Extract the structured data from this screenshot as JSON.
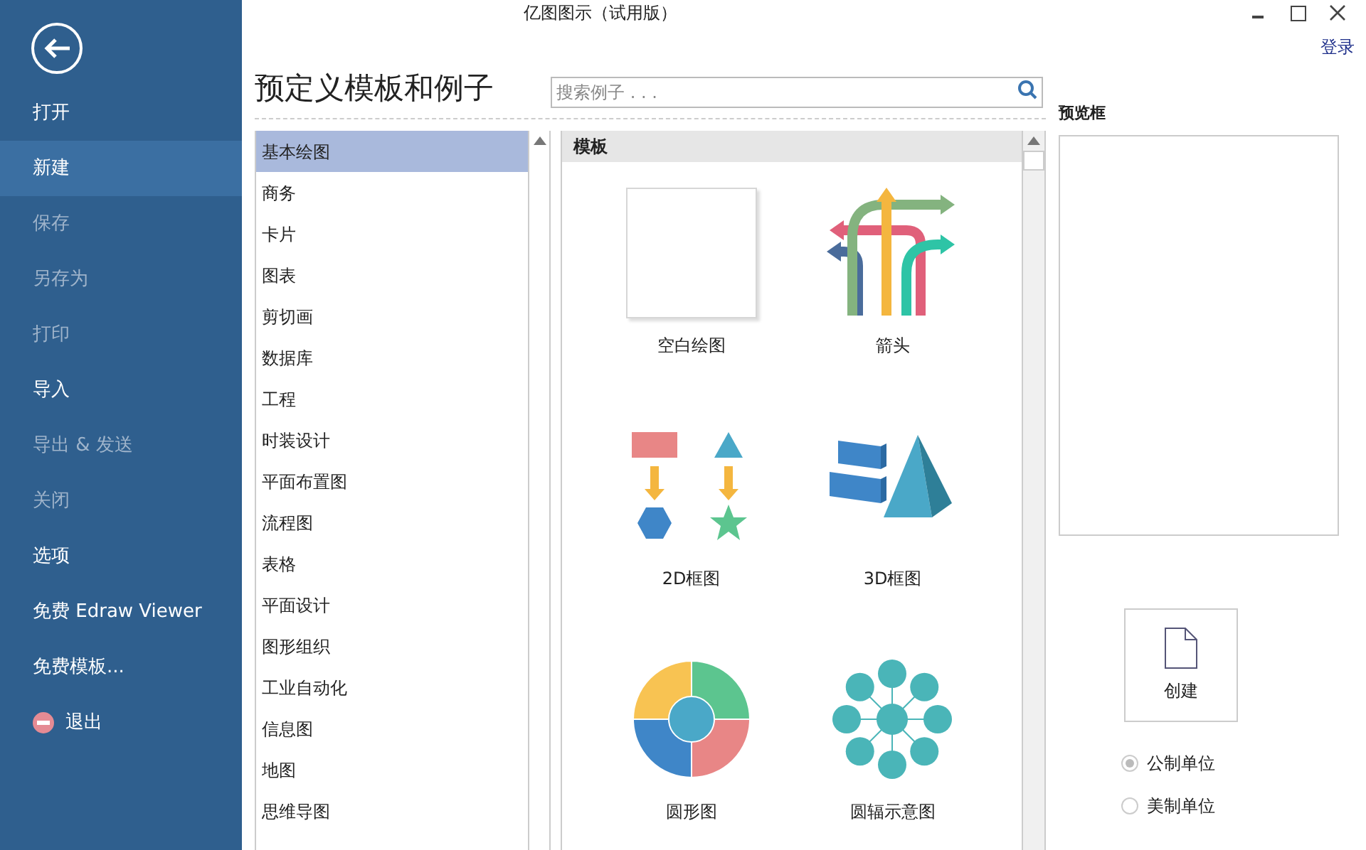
{
  "window": {
    "title": "亿图图示（试用版）",
    "login": "登录"
  },
  "sidebar": {
    "items": [
      {
        "label": "打开",
        "kind": "item",
        "selected": false,
        "disabled": false
      },
      {
        "label": "新建",
        "kind": "item",
        "selected": true,
        "disabled": false
      },
      {
        "label": "保存",
        "kind": "item",
        "selected": false,
        "disabled": true
      },
      {
        "label": "另存为",
        "kind": "item",
        "selected": false,
        "disabled": true
      },
      {
        "label": "打印",
        "kind": "item",
        "selected": false,
        "disabled": true
      },
      {
        "label": "导入",
        "kind": "item",
        "selected": false,
        "disabled": false
      },
      {
        "label": "导出 & 发送",
        "kind": "item",
        "selected": false,
        "disabled": true
      },
      {
        "label": "关闭",
        "kind": "item",
        "selected": false,
        "disabled": true
      },
      {
        "label": "选项",
        "kind": "item",
        "selected": false,
        "disabled": false
      },
      {
        "label": "免费 Edraw Viewer",
        "kind": "item",
        "selected": false,
        "disabled": false
      },
      {
        "label": "免费模板...",
        "kind": "item",
        "selected": false,
        "disabled": false
      },
      {
        "label": "退出",
        "kind": "exit",
        "selected": false,
        "disabled": false
      }
    ]
  },
  "heading": "预定义模板和例子",
  "search": {
    "placeholder": "搜索例子 . . ."
  },
  "categories": [
    {
      "label": "基本绘图",
      "selected": true
    },
    {
      "label": "商务",
      "selected": false
    },
    {
      "label": "卡片",
      "selected": false
    },
    {
      "label": "图表",
      "selected": false
    },
    {
      "label": "剪切画",
      "selected": false
    },
    {
      "label": "数据库",
      "selected": false
    },
    {
      "label": "工程",
      "selected": false
    },
    {
      "label": "时装设计",
      "selected": false
    },
    {
      "label": "平面布置图",
      "selected": false
    },
    {
      "label": "流程图",
      "selected": false
    },
    {
      "label": "表格",
      "selected": false
    },
    {
      "label": "平面设计",
      "selected": false
    },
    {
      "label": "图形组织",
      "selected": false
    },
    {
      "label": "工业自动化",
      "selected": false
    },
    {
      "label": "信息图",
      "selected": false
    },
    {
      "label": "地图",
      "selected": false
    },
    {
      "label": "思维导图",
      "selected": false
    }
  ],
  "templates": {
    "header": "模板",
    "items": [
      {
        "label": "空白绘图",
        "kind": "blank"
      },
      {
        "label": "箭头",
        "kind": "arrows"
      },
      {
        "label": "2D框图",
        "kind": "flat"
      },
      {
        "label": "3D框图",
        "kind": "solid"
      },
      {
        "label": "圆形图",
        "kind": "circle"
      },
      {
        "label": "圆辐示意图",
        "kind": "radial"
      }
    ]
  },
  "preview": {
    "title": "预览框"
  },
  "create_button": "创建",
  "units": [
    {
      "label": "公制单位",
      "selected": true
    },
    {
      "label": "美制单位",
      "selected": false
    }
  ]
}
